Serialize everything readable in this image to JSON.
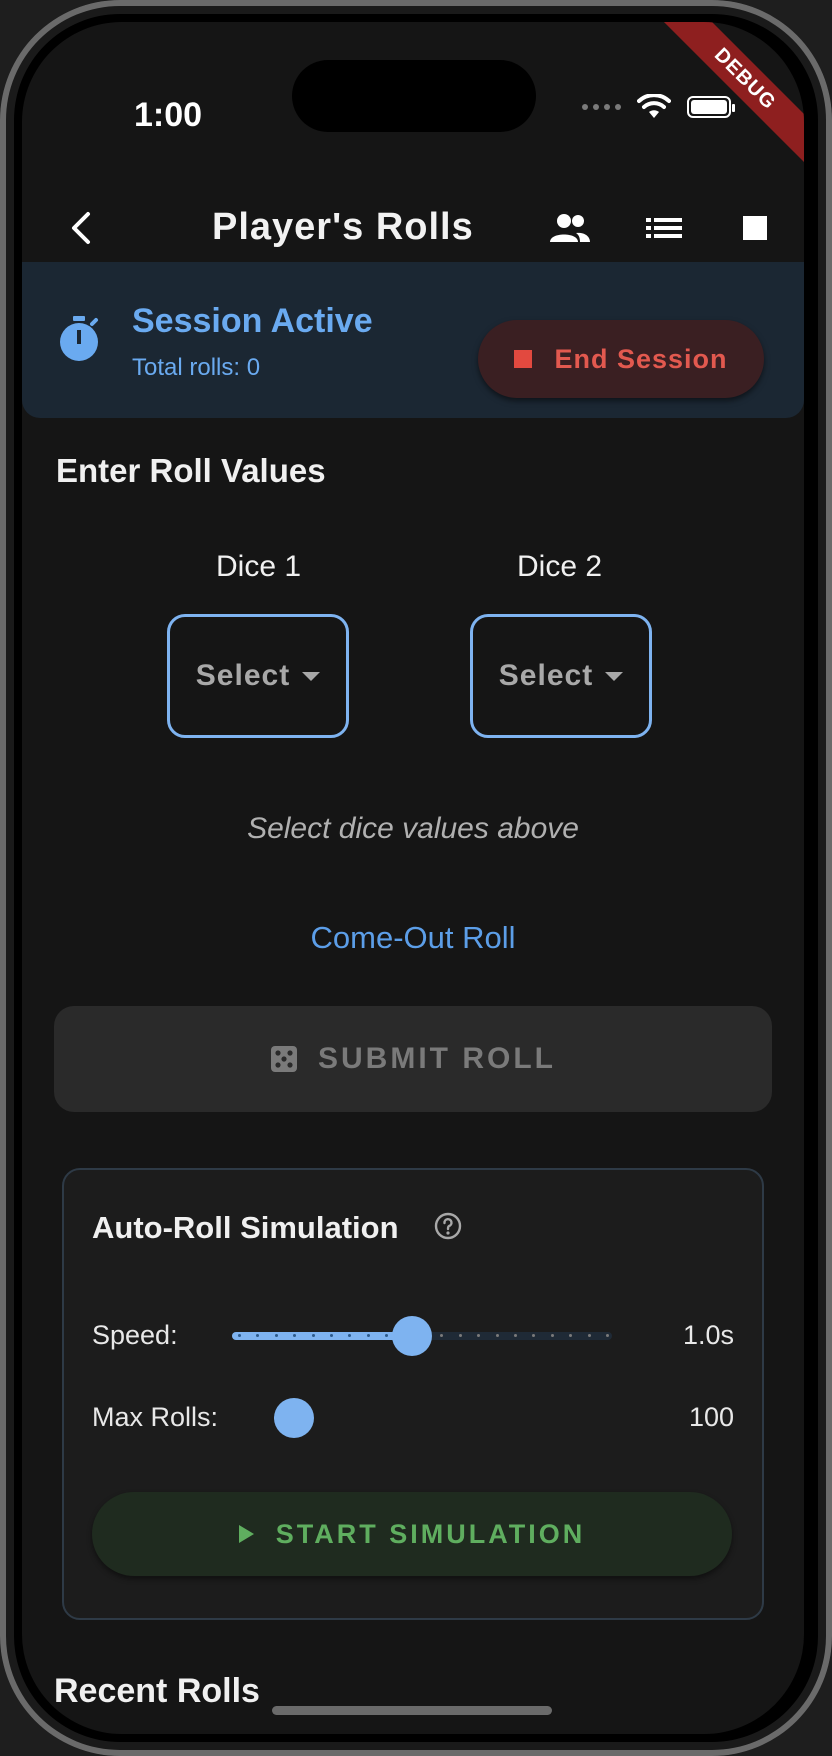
{
  "status_bar": {
    "time": "1:00"
  },
  "debug_banner": "DEBUG",
  "app_bar": {
    "title": "Player's Rolls"
  },
  "session": {
    "title": "Session Active",
    "total_rolls": "Total rolls: 0",
    "end_label": "End Session"
  },
  "roll_entry": {
    "heading": "Enter Roll Values",
    "dice": [
      {
        "label": "Dice 1",
        "value": "Select"
      },
      {
        "label": "Dice 2",
        "value": "Select"
      }
    ],
    "hint": "Select dice values above",
    "phase": "Come-Out Roll",
    "submit_label": "SUBMIT ROLL"
  },
  "simulation": {
    "title": "Auto-Roll Simulation",
    "speed_label": "Speed:",
    "speed_value": "1.0s",
    "speed_fraction": 0.47,
    "max_rolls_label": "Max Rolls:",
    "max_rolls_value": "100",
    "max_rolls_fraction": 0.0,
    "start_label": "START SIMULATION"
  },
  "recent_heading": "Recent Rolls",
  "colors": {
    "accent": "#7eb3f0",
    "session_text": "#6aaaf0",
    "danger": "#e2594f",
    "success": "#5fae5f"
  }
}
